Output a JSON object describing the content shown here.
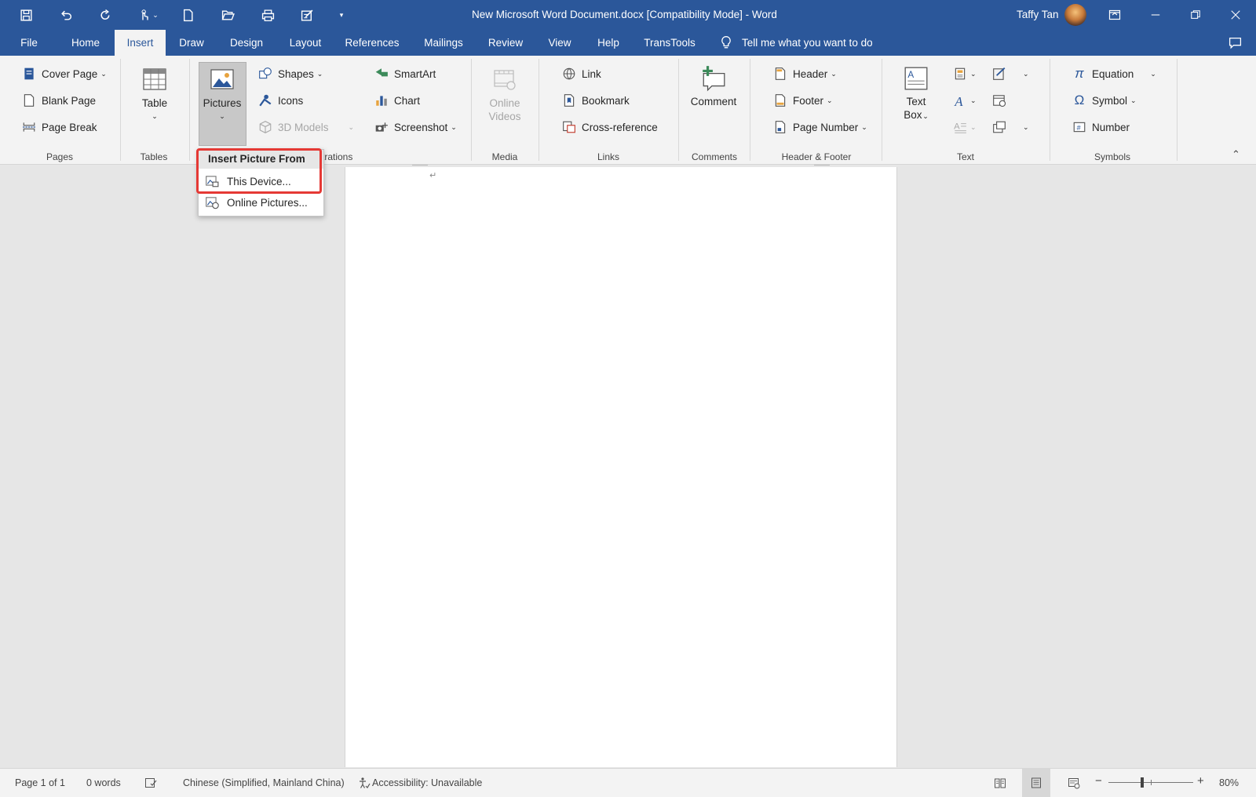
{
  "titlebar": {
    "title": "New Microsoft Word Document.docx [Compatibility Mode]  -  Word",
    "user": "Taffy Tan"
  },
  "tabs": [
    "File",
    "Home",
    "Insert",
    "Draw",
    "Design",
    "Layout",
    "References",
    "Mailings",
    "Review",
    "View",
    "Help",
    "TransTools"
  ],
  "active_tab": "Insert",
  "tellme": "Tell me what you want to do",
  "ribbon": {
    "pages": {
      "cover": "Cover Page",
      "blank": "Blank Page",
      "break": "Page Break",
      "label": "Pages"
    },
    "tables": {
      "table": "Table",
      "label": "Tables"
    },
    "illustrations": {
      "pictures": "Pictures",
      "shapes": "Shapes",
      "icons": "Icons",
      "models": "3D Models",
      "smartart": "SmartArt",
      "chart": "Chart",
      "screenshot": "Screenshot",
      "label": "trations"
    },
    "media": {
      "online1": "Online",
      "online2": "Videos",
      "label": "Media"
    },
    "links": {
      "link": "Link",
      "bookmark": "Bookmark",
      "crossref": "Cross-reference",
      "label": "Links"
    },
    "comments": {
      "comment": "Comment",
      "label": "Comments"
    },
    "hf": {
      "header": "Header",
      "footer": "Footer",
      "pagenum": "Page Number",
      "label": "Header & Footer"
    },
    "text": {
      "textbox1": "Text",
      "textbox2": "Box",
      "label": "Text"
    },
    "symbols": {
      "equation": "Equation",
      "symbol": "Symbol",
      "number": "Number",
      "label": "Symbols"
    }
  },
  "menu": {
    "header": "Insert Picture From",
    "items": [
      "This Device...",
      "Online Pictures..."
    ]
  },
  "status": {
    "page": "Page 1 of 1",
    "words": "0 words",
    "language": "Chinese (Simplified, Mainland China)",
    "accessibility": "Accessibility: Unavailable",
    "zoom": "80%"
  },
  "colors": {
    "accent": "#2b579a",
    "highlight": "#e53935"
  }
}
